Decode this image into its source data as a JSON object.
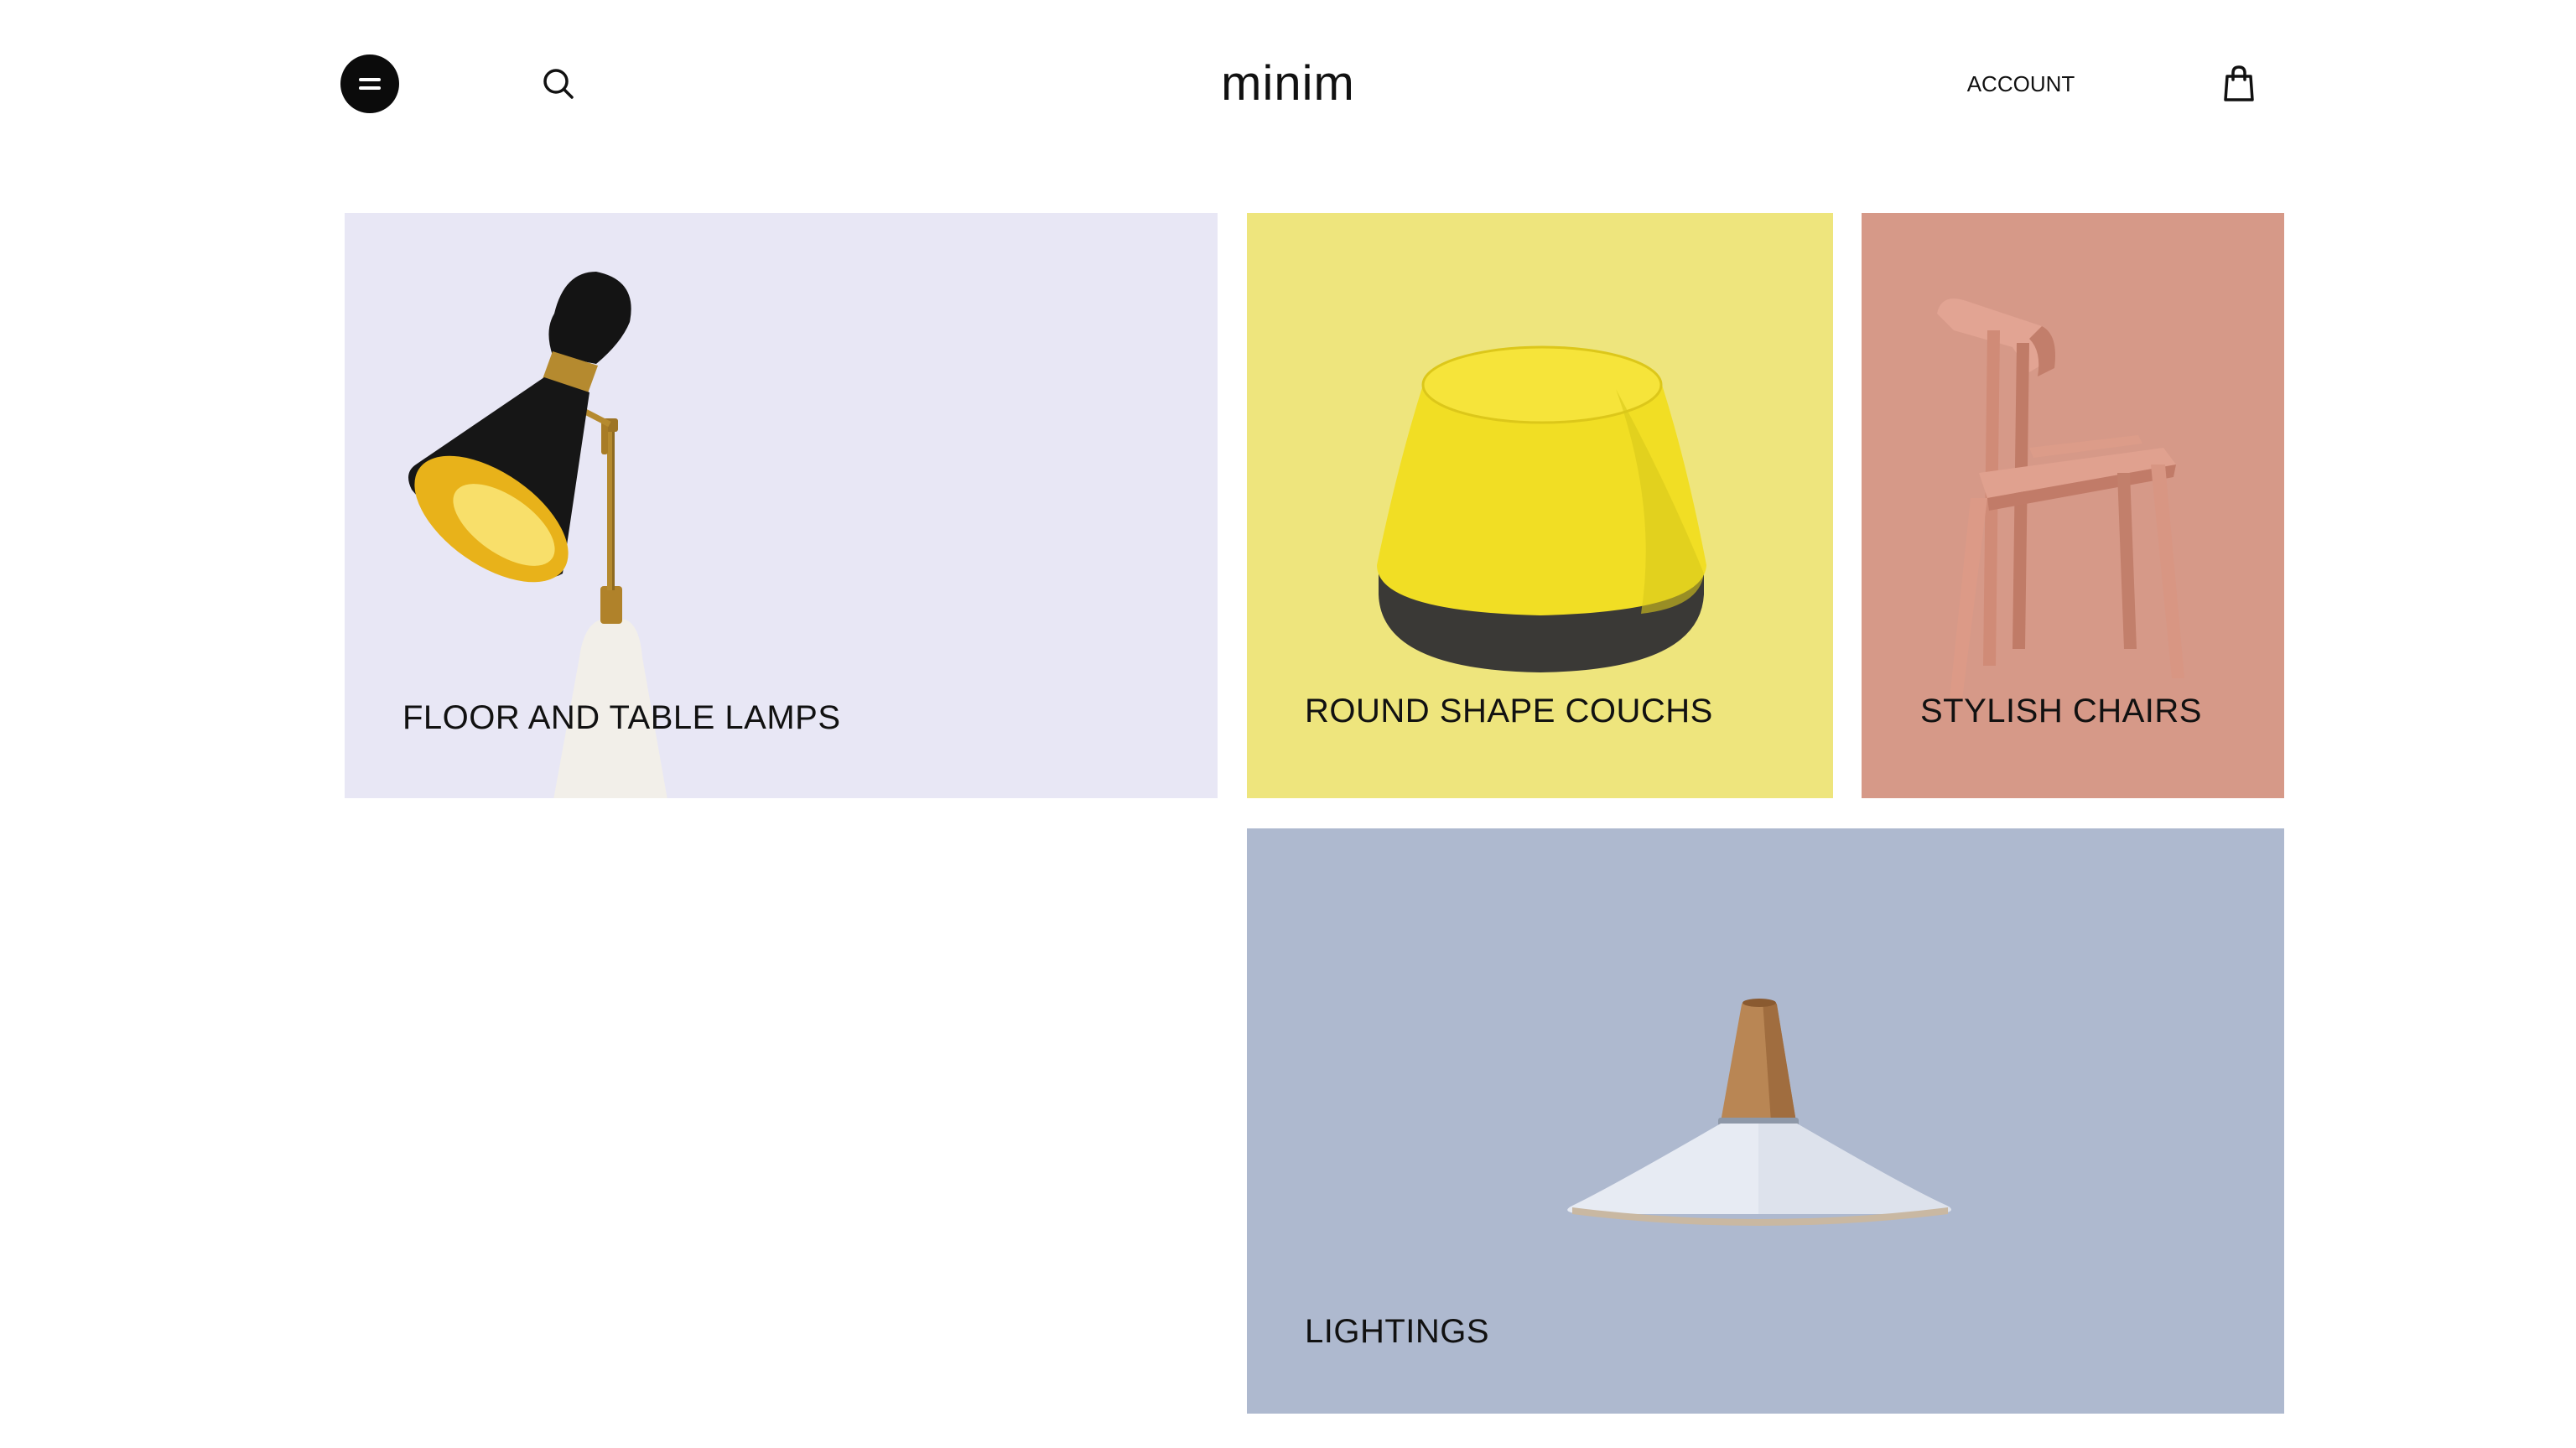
{
  "header": {
    "logo": "minim",
    "account_label": "ACCOUNT",
    "icons": {
      "menu": "menu-icon",
      "search": "search-icon",
      "cart": "shopping-bag-icon"
    }
  },
  "categories": [
    {
      "label": "FLOOR AND TABLE LAMPS",
      "bg": "#E8E7F5",
      "image": "table-lamp-image"
    },
    {
      "label": "ROUND SHAPE COUCHS",
      "bg": "#EEE57D",
      "image": "yellow-pouf-image"
    },
    {
      "label": "STYLISH CHAIRS",
      "bg": "#D69988",
      "image": "wooden-chair-image"
    },
    {
      "label": "LIGHTINGS",
      "bg": "#AEB9CF",
      "image": "pendant-lamp-image"
    }
  ]
}
